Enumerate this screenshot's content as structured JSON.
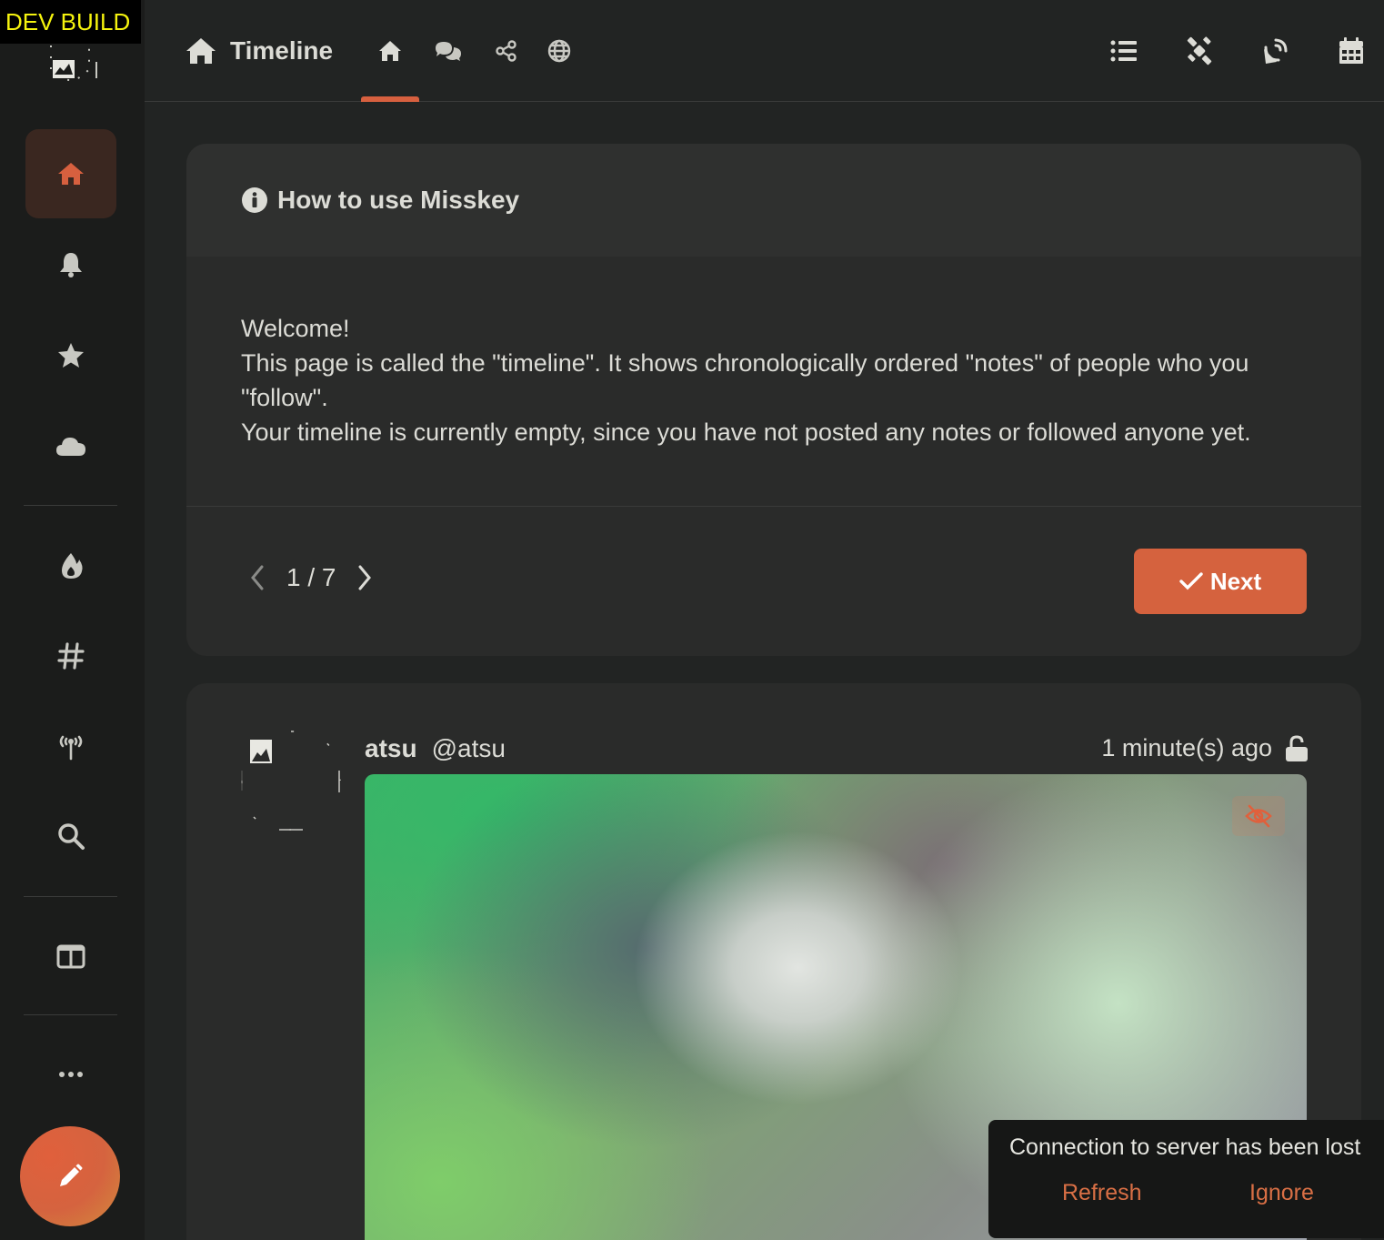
{
  "app": {
    "dev_badge": "DEV BUILD",
    "accent_color": "#d5623e"
  },
  "sidebar": {
    "items": [
      {
        "name": "home",
        "icon": "home-icon",
        "active": true
      },
      {
        "name": "notifications",
        "icon": "bell-icon"
      },
      {
        "name": "favorites",
        "icon": "star-icon"
      },
      {
        "name": "drive",
        "icon": "cloud-icon"
      },
      {
        "name": "explore",
        "icon": "fire-icon"
      },
      {
        "name": "hashtags",
        "icon": "hashtag-icon"
      },
      {
        "name": "channels",
        "icon": "antenna-icon"
      },
      {
        "name": "search",
        "icon": "search-icon"
      },
      {
        "name": "deck",
        "icon": "columns-icon"
      },
      {
        "name": "more",
        "icon": "ellipsis-icon"
      }
    ],
    "post_button_icon": "pencil-icon"
  },
  "header": {
    "title": "Timeline",
    "tabs": [
      {
        "name": "home",
        "icon": "home-icon",
        "active": true
      },
      {
        "name": "local",
        "icon": "comments-icon"
      },
      {
        "name": "social",
        "icon": "share-icon"
      },
      {
        "name": "global",
        "icon": "globe-icon"
      }
    ],
    "actions": [
      {
        "name": "lists",
        "icon": "list-icon"
      },
      {
        "name": "antennas",
        "icon": "satellite-icon"
      },
      {
        "name": "channels",
        "icon": "satellite-dish-icon"
      },
      {
        "name": "calendar",
        "icon": "calendar-icon"
      }
    ]
  },
  "tutorial": {
    "title": "How to use Misskey",
    "line1": "Welcome!",
    "line2": "This page is called the \"timeline\". It shows chronologically ordered \"notes\" of people who you \"follow\".",
    "line3": "Your timeline is currently empty, since you have not posted any notes or followed anyone yet.",
    "page": "1 / 7",
    "next_label": "Next"
  },
  "note": {
    "display_name": "atsu",
    "username": "@atsu",
    "time": "1 minute(s) ago",
    "visibility_icon": "unlock-icon",
    "media_sensitive_icon": "eye-slash-icon"
  },
  "toast": {
    "message": "Connection to server has been lost",
    "refresh_label": "Refresh",
    "ignore_label": "Ignore"
  }
}
